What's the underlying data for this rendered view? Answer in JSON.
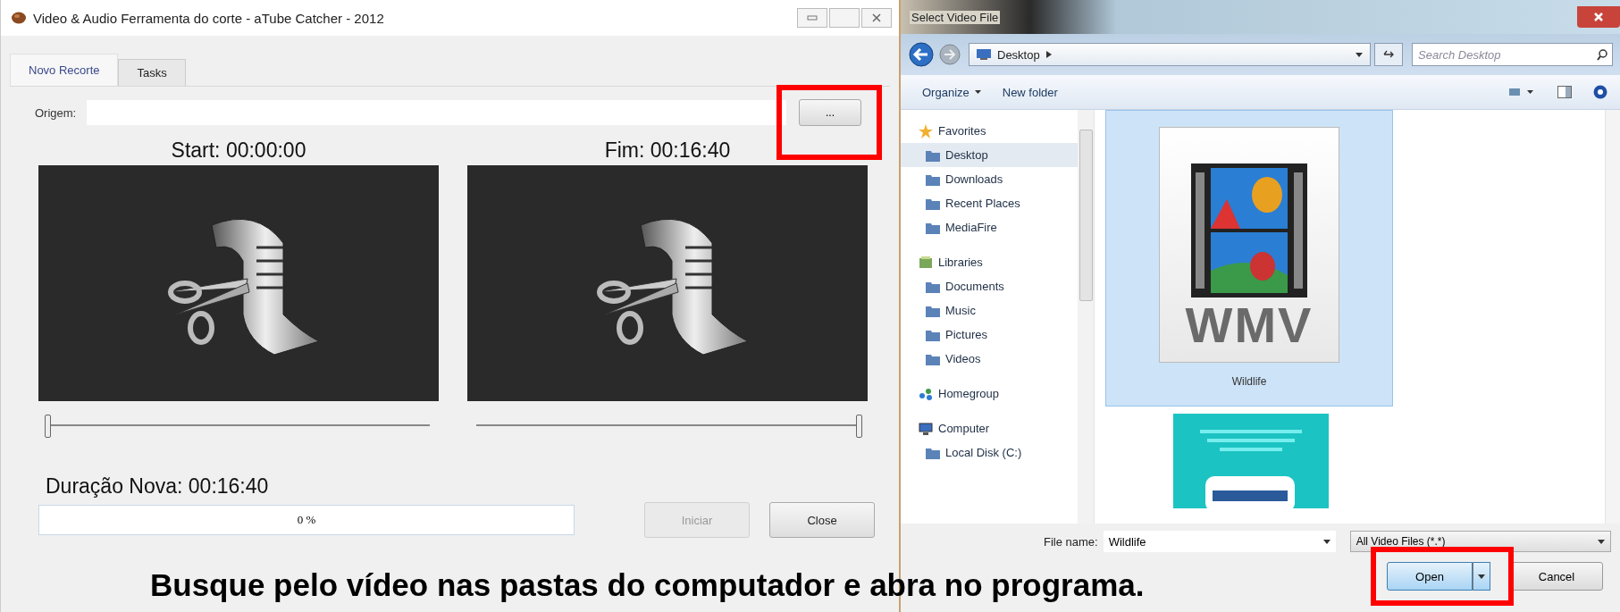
{
  "main_window": {
    "title": "Video & Audio Ferramenta do corte - aTube Catcher - 2012",
    "tabs": [
      {
        "label": "Novo Recorte",
        "selected": true
      },
      {
        "label": "Tasks",
        "selected": false
      }
    ],
    "origin": {
      "label": "Origem:",
      "browse_button": "..."
    },
    "start_label": "Start: 00:00:00",
    "end_label": "Fim: 00:16:40",
    "sliders": [
      {
        "level": 0
      },
      {
        "level": 1
      }
    ],
    "duration": "Duração Nova: 00:16:40",
    "progress": {
      "level": 0,
      "reading": "0 %"
    },
    "buttons": [
      {
        "label": "Iniciar",
        "disabled": true
      },
      {
        "label": "Close",
        "disabled": false
      }
    ]
  },
  "file_dialog": {
    "title": "Select Video File",
    "breadcrumb": "Desktop",
    "search": {
      "placeholder": "Search Desktop"
    },
    "toolbar": [
      "Organize",
      "New folder"
    ],
    "nav": [
      {
        "label": "Favorites",
        "selected": false,
        "children": [
          {
            "label": "Desktop",
            "selected": true
          },
          {
            "label": "Downloads",
            "selected": false
          },
          {
            "label": "Recent Places",
            "selected": false
          },
          {
            "label": "MediaFire",
            "selected": false
          }
        ]
      },
      {
        "label": "Libraries",
        "selected": false,
        "children": [
          {
            "label": "Documents",
            "selected": false
          },
          {
            "label": "Music",
            "selected": false
          },
          {
            "label": "Pictures",
            "selected": false
          },
          {
            "label": "Videos",
            "selected": false
          }
        ]
      },
      {
        "label": "Homegroup",
        "selected": false
      },
      {
        "label": "Computer",
        "selected": false,
        "children": [
          {
            "label": "Local Disk (C:)",
            "selected": false
          }
        ]
      }
    ],
    "files": [
      {
        "kind": "video",
        "name": "Wildlife",
        "badge": "WMV",
        "selected": true
      },
      {
        "kind": "picture",
        "selected": false
      }
    ],
    "file_name": {
      "label": "File name:",
      "value": "Wildlife"
    },
    "file_type": "All Video Files (*.*)",
    "open_button": "Open",
    "cancel_button": "Cancel"
  },
  "caption": "Busque pelo vídeo nas pastas do computador e abra no programa."
}
